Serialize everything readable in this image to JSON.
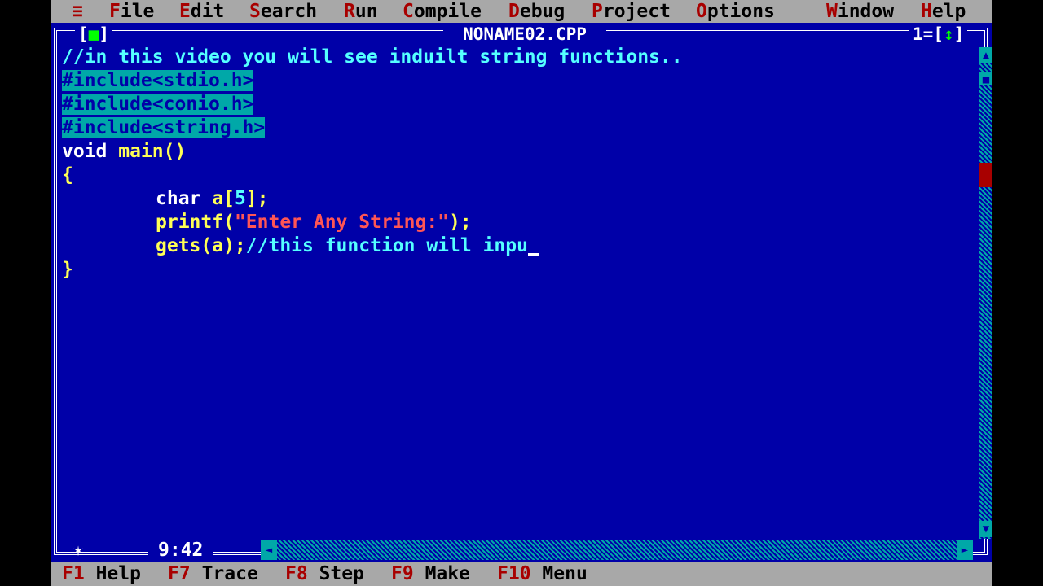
{
  "menu": {
    "system": "≡",
    "items": [
      {
        "hot": "F",
        "rest": "ile"
      },
      {
        "hot": "E",
        "rest": "dit"
      },
      {
        "hot": "S",
        "rest": "earch"
      },
      {
        "hot": "R",
        "rest": "un"
      },
      {
        "hot": "C",
        "rest": "ompile"
      },
      {
        "hot": "D",
        "rest": "ebug"
      },
      {
        "hot": "P",
        "rest": "roject"
      },
      {
        "hot": "O",
        "rest": "ptions"
      },
      {
        "hot": "W",
        "rest": "indow"
      },
      {
        "hot": "H",
        "rest": "elp"
      }
    ]
  },
  "window": {
    "title": "NONAME02.CPP",
    "close_box_left": "[",
    "close_box_mark": "■",
    "close_box_right": "]",
    "number": "1",
    "zoom_left": "[",
    "zoom_mark": "↕",
    "zoom_right": "]"
  },
  "code": {
    "line1": "//in this video you will see induilt string functions..",
    "line2": "#include<stdio.h>",
    "line3": "#include<conio.h>",
    "line4": "#include<string.h>",
    "line5_kw": "void",
    "line5_rest": " main()",
    "line6": "{",
    "line7_indent": "\t",
    "line7_kw": "char",
    "line7_id": " a[",
    "line7_num": "5",
    "line7_end": "];",
    "line8_id": "printf(",
    "line8_str": "\"Enter Any String:\"",
    "line8_end": ");",
    "line9_id": "gets(a);",
    "line9_cmt": "//this function will inpu",
    "line10": "}"
  },
  "status": {
    "position": "9:42",
    "marker": "✶"
  },
  "fkeys": [
    {
      "key": "F1",
      "label": "Help"
    },
    {
      "key": "F7",
      "label": "Trace"
    },
    {
      "key": "F8",
      "label": "Step"
    },
    {
      "key": "F9",
      "label": "Make"
    },
    {
      "key": "F10",
      "label": "Menu"
    }
  ],
  "colors": {
    "background": "#0000a8",
    "menu": "#a8a8a8",
    "hotkey": "#a80000",
    "comment": "#55ffff",
    "string": "#ff5555"
  }
}
